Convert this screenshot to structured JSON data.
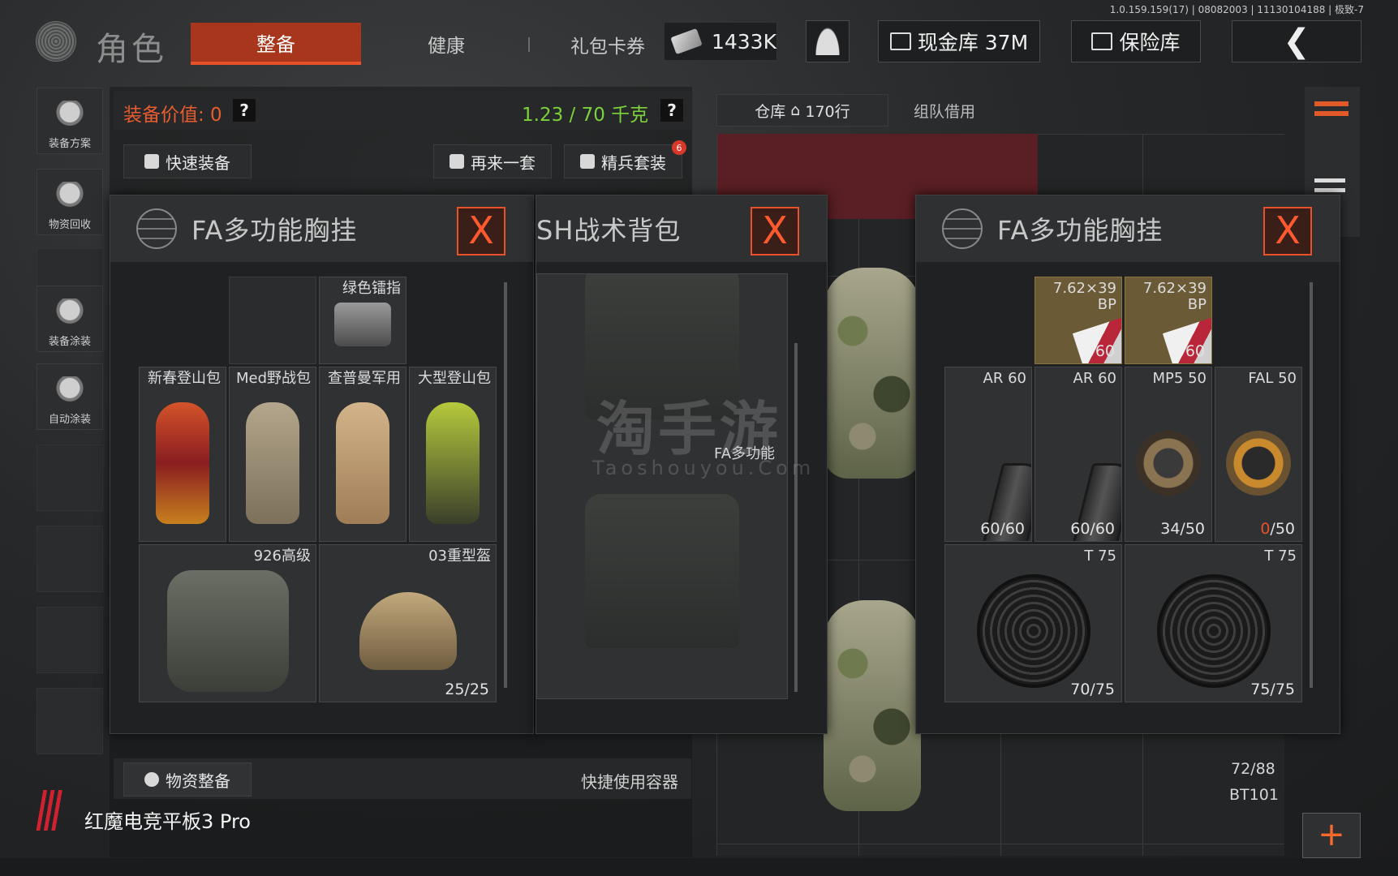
{
  "version": "1.0.159.159(17) | 08082003 | 11130104188 | 极致-7",
  "header": {
    "title": "角色",
    "tabs": [
      {
        "label": "整备",
        "active": true
      },
      {
        "label": "健康",
        "active": false
      }
    ],
    "gift_label": "礼包卡券",
    "gift_value": "1433K",
    "cash_label": "现金库 37M",
    "vault_label": "保险库"
  },
  "sidebar": [
    {
      "label": "装备方案",
      "icon": "helmet-grid-icon"
    },
    {
      "label": "物资回收",
      "icon": "recycle-icon"
    },
    {
      "label": "装备涂装",
      "icon": "spray-helmet-icon"
    },
    {
      "label": "自动涂装",
      "icon": "auto-spray-icon"
    }
  ],
  "equipment": {
    "value_label": "装备价值: 0",
    "help": "?",
    "weight": "1.23 / 70 千克",
    "quick_equip": "快速装备",
    "again": "再来一套",
    "elite_set": "精兵套装",
    "elite_badge": "6"
  },
  "windows": {
    "left": {
      "title": "FA多功能胸挂",
      "close": "X",
      "items": [
        {
          "label": "绿色镭指"
        },
        {
          "label": "新春登山包"
        },
        {
          "label": "Med野战包"
        },
        {
          "label": "查普曼军用"
        },
        {
          "label": "大型登山包"
        },
        {
          "label": "926高级"
        },
        {
          "label": "03重型盔",
          "count": "25/25"
        }
      ]
    },
    "middle": {
      "title": "SH战术背包",
      "close": "X",
      "caption": "FA多功能"
    },
    "right": {
      "title": "FA多功能胸挂",
      "close": "X",
      "ammo": [
        {
          "label": "7.62×39 BP",
          "count": "60"
        },
        {
          "label": "7.62×39 BP",
          "count": "60"
        }
      ],
      "mags": [
        {
          "label": "AR 60",
          "count": "60/60"
        },
        {
          "label": "AR 60",
          "count": "60/60"
        },
        {
          "label": "MP5 50",
          "count": "34/50"
        },
        {
          "label": "FAL 50",
          "count_zero": "0",
          "count_rest": "/50"
        }
      ],
      "drums": [
        {
          "label": "T 75",
          "count": "70/75"
        },
        {
          "label": "T 75",
          "count": "75/75"
        }
      ]
    }
  },
  "warehouse": {
    "tab_label": "仓库",
    "rows": "170行",
    "team_borrow": "组队借用",
    "count_label": "72/88",
    "item_label": "BT101"
  },
  "bottom": {
    "supply": "物资整备",
    "quick_use": "快捷使用容器",
    "device": "红魔电竞平板3 Pro"
  },
  "watermark": {
    "main": "淘手游",
    "sub": "Taoshouyou.Com"
  },
  "colors": {
    "accent": "#e9512b",
    "active_tab": "#a8361c",
    "weight": "#7dd23c",
    "ammo_cell": "#6b5a36"
  }
}
